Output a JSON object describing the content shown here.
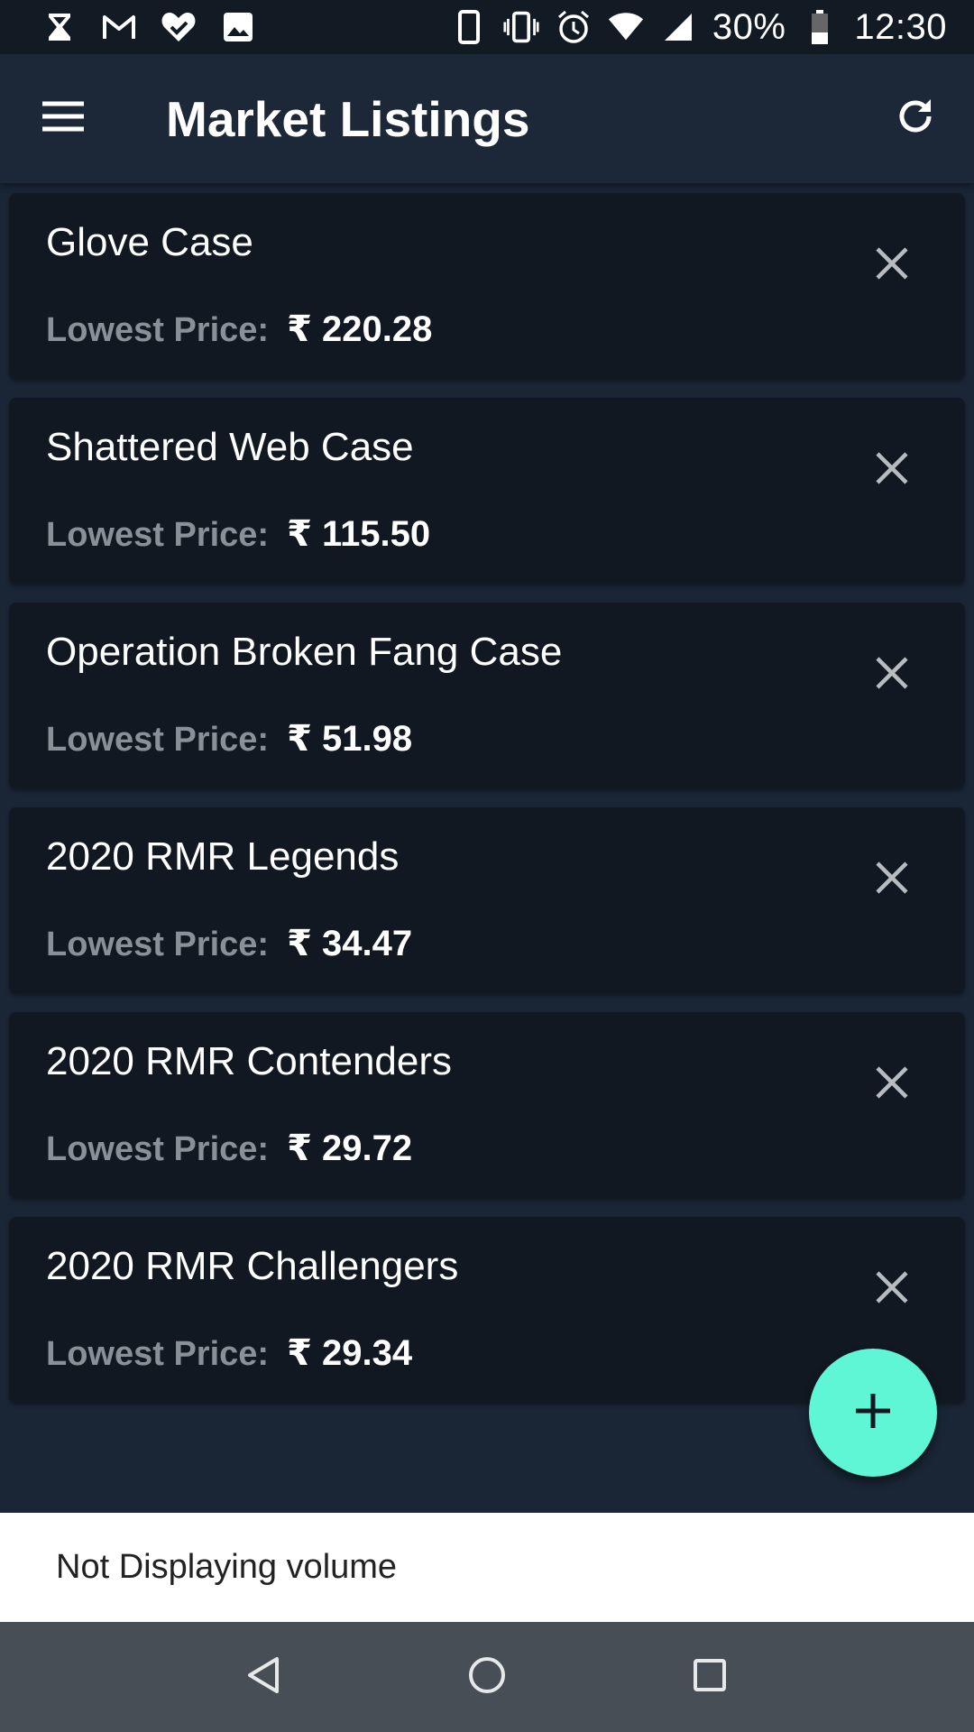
{
  "status_bar": {
    "icons_left": [
      "hourglass-icon",
      "gmail-icon",
      "heart-check-icon",
      "image-icon"
    ],
    "icons_right": [
      "phone-icon",
      "vibrate-icon",
      "alarm-icon",
      "wifi-icon",
      "signal-icon",
      "battery-icon"
    ],
    "battery": "30%",
    "time": "12:30"
  },
  "app_bar": {
    "title": "Market Listings",
    "menu_icon": "hamburger-menu-icon",
    "refresh_icon": "refresh-icon"
  },
  "listings": [
    {
      "name": "Glove Case",
      "price_label": "Lowest Price:",
      "price": "₹ 220.28"
    },
    {
      "name": "Shattered Web Case",
      "price_label": "Lowest Price:",
      "price": "₹ 115.50"
    },
    {
      "name": "Operation Broken Fang Case",
      "price_label": "Lowest Price:",
      "price": "₹ 51.98"
    },
    {
      "name": "2020 RMR Legends",
      "price_label": "Lowest Price:",
      "price": "₹ 34.47"
    },
    {
      "name": "2020 RMR Contenders",
      "price_label": "Lowest Price:",
      "price": "₹ 29.72"
    },
    {
      "name": "2020 RMR Challengers",
      "price_label": "Lowest Price:",
      "price": "₹ 29.34"
    }
  ],
  "fab": {
    "icon": "plus-icon"
  },
  "snackbar": {
    "text": "Not Displaying volume"
  },
  "colors": {
    "background": "#1a2636",
    "card": "#111821",
    "app_bar": "#1c2837",
    "accent": "#5ff6d6",
    "label_gray": "#8a9097"
  }
}
